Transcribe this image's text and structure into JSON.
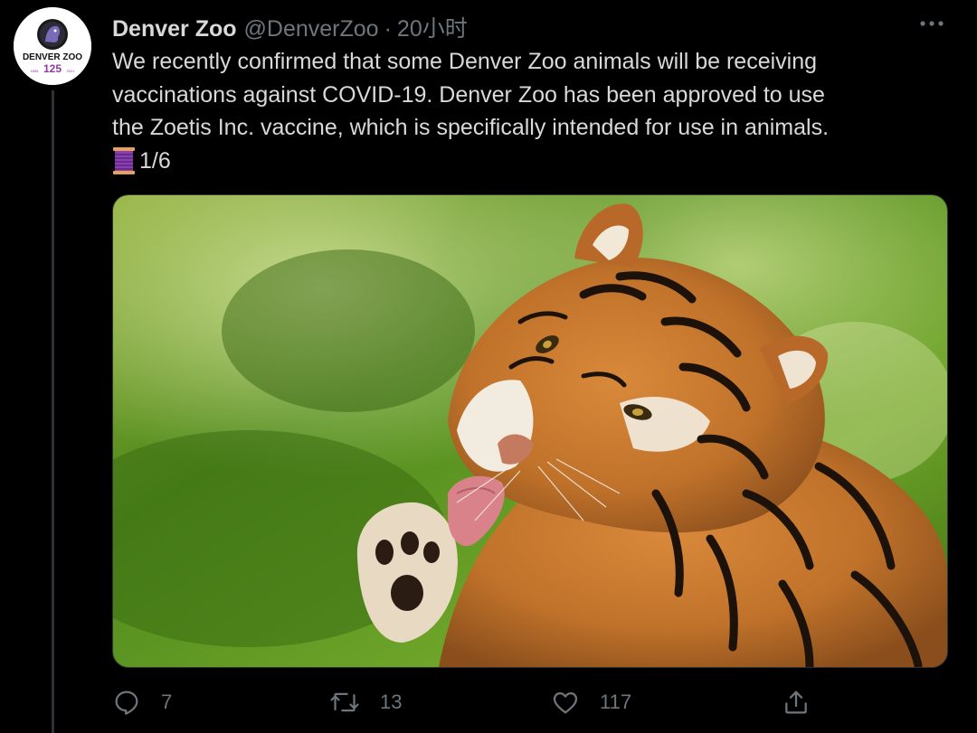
{
  "tweet": {
    "author": {
      "display_name": "Denver Zoo",
      "handle": "@DenverZoo",
      "avatar": {
        "logo_text": "DENVER ZOO",
        "number": "125",
        "year_start": "1896",
        "year_end": "2021",
        "accent_color": "#8e3a9c"
      }
    },
    "separator": "·",
    "timestamp": "20小时",
    "text_lines": [
      "We recently confirmed that some Denver Zoo animals will be receiving",
      "vaccinations against COVID-19.  Denver Zoo has been approved to use",
      "the Zoetis Inc. vaccine, which is specifically intended for use in animals."
    ],
    "thread_marker": "1/6",
    "thread_emoji_icon": "spool-of-thread-icon",
    "media": {
      "kind": "photo",
      "subject": "tiger-licking-paw-photo"
    },
    "actions": {
      "reply": {
        "icon": "reply-icon",
        "count": "7"
      },
      "retweet": {
        "icon": "retweet-icon",
        "count": "13"
      },
      "like": {
        "icon": "heart-icon",
        "count": "117"
      },
      "share": {
        "icon": "share-icon"
      }
    }
  },
  "colors": {
    "background": "#000000",
    "text": "#d9d9d9",
    "muted": "#6e767d",
    "border": "#2f3336"
  }
}
